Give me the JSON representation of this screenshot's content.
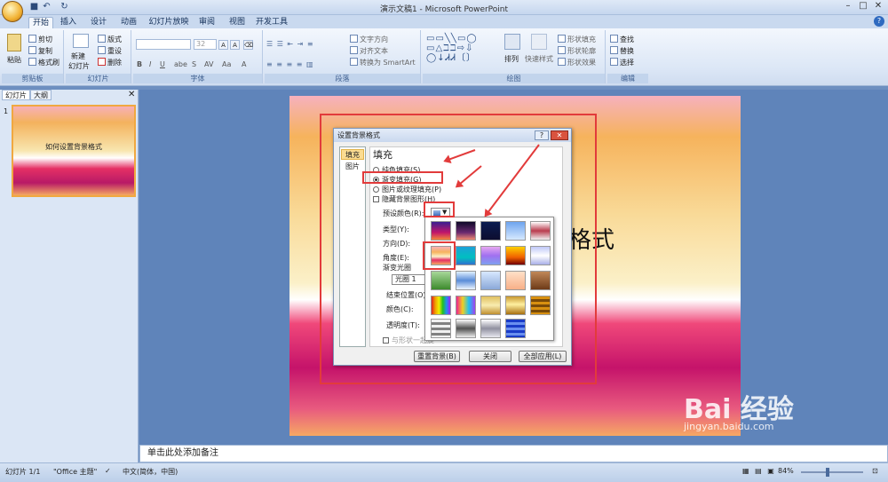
{
  "window": {
    "title": "演示文稿1 - Microsoft PowerPoint"
  },
  "tabs": [
    "开始",
    "插入",
    "设计",
    "动画",
    "幻灯片放映",
    "审阅",
    "视图",
    "开发工具"
  ],
  "ribbon": {
    "clipboard": {
      "paste": "粘贴",
      "cut": "剪切",
      "copy": "复制",
      "format_painter": "格式刷",
      "label": "剪贴板"
    },
    "slides": {
      "new_slide": "新建",
      "new_slide2": "幻灯片",
      "layout": "版式",
      "reset": "重设",
      "delete": "删除",
      "label": "幻灯片"
    },
    "font": {
      "size": "32",
      "label": "字体"
    },
    "paragraph": {
      "text_direction": "文字方向",
      "align_text": "对齐文本",
      "smartart": "转换为 SmartArt",
      "label": "段落"
    },
    "drawing": {
      "arrange": "排列",
      "quick_styles": "快速样式",
      "shape_fill": "形状填充",
      "shape_outline": "形状轮廓",
      "shape_effects": "形状效果",
      "label": "绘图"
    },
    "editing": {
      "find": "查找",
      "replace": "替换",
      "select": "选择",
      "label": "编辑"
    }
  },
  "left_panel": {
    "tab_slides": "幻灯片",
    "tab_outline": "大纲",
    "slide_number": "1",
    "thumb_text": "如何设置背景格式"
  },
  "slide": {
    "title_fragment": "格式"
  },
  "notes": {
    "placeholder": "单击此处添加备注"
  },
  "status": {
    "slide": "幻灯片 1/1",
    "theme": "\"Office 主题\"",
    "language": "中文(简体，中国)",
    "zoom": "84%"
  },
  "dialog": {
    "title": "设置背景格式",
    "nav_fill": "填充",
    "nav_picture": "图片",
    "heading": "填充",
    "opt_solid": "纯色填充(S)",
    "opt_gradient": "渐变填充(G)",
    "opt_picture": "图片或纹理填充(P)",
    "opt_hide": "隐藏背景图形(H)",
    "preset_label": "预设颜色(R):",
    "type_label": "类型(Y):",
    "direction_label": "方向(D):",
    "angle_label": "角度(E):",
    "stops_label": "渐变光圈",
    "stop_value": "光圈 1",
    "end_pos_label": "结束位置(O):",
    "color_label": "颜色(C):",
    "transparency_label": "透明度(T):",
    "rotate_label": "与形状一起旋",
    "btn_reset": "重置背景(B)",
    "btn_close": "关闭",
    "btn_apply_all": "全部应用(L)"
  },
  "watermark": {
    "brand": "Bai 经验",
    "url": "jingyan.baidu.com"
  }
}
